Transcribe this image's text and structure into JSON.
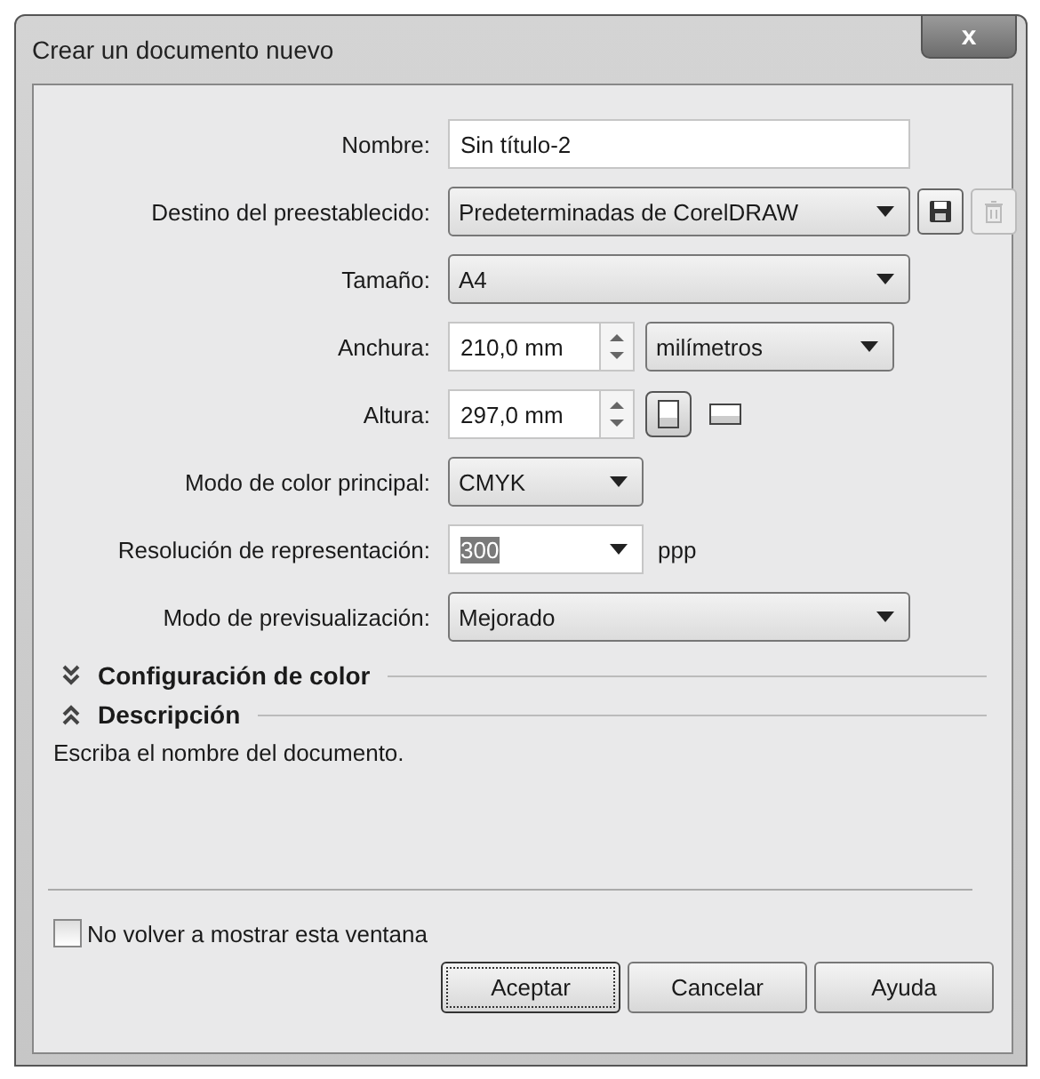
{
  "window": {
    "title": "Crear un documento nuevo",
    "close": "x"
  },
  "rows": [
    {
      "kind": "text",
      "label": "Nombre:",
      "value": "Sin título-2"
    },
    {
      "kind": "preset",
      "label": "Destino del preestablecido:",
      "value": "Predeterminadas de CorelDRAW",
      "tools": [
        {
          "kind": "save",
          "disabled": false
        },
        {
          "kind": "delete",
          "disabled": true
        }
      ]
    },
    {
      "kind": "dropdown",
      "label": "Tamaño:",
      "value": "A4"
    },
    {
      "kind": "spin",
      "label": "Anchura:",
      "value": "210,0 mm",
      "unit": "milímetros"
    },
    {
      "kind": "spin",
      "label": "Altura:",
      "value": "297,0 mm",
      "orientations": [
        {
          "kind": "portrait",
          "selected": true
        },
        {
          "kind": "landscape",
          "selected": false
        }
      ]
    },
    {
      "kind": "short-dropdown",
      "label": "Modo de color principal:",
      "value": "CMYK"
    },
    {
      "kind": "combo",
      "label": "Resolución de representación:",
      "value": "300",
      "value_selected": true,
      "suffix": "ppp"
    },
    {
      "kind": "dropdown",
      "label": "Modo de previsualización:",
      "value": "Mejorado"
    }
  ],
  "sections": [
    {
      "title": "Configuración de color",
      "expanded": false
    },
    {
      "title": "Descripción",
      "expanded": true
    }
  ],
  "description": "Escriba el nombre del documento.",
  "checkbox": {
    "label": "No volver a mostrar esta ventana",
    "checked": false
  },
  "buttons": [
    {
      "label": "Aceptar",
      "default": true
    },
    {
      "label": "Cancelar",
      "default": false
    },
    {
      "label": "Ayuda",
      "default": false
    }
  ]
}
